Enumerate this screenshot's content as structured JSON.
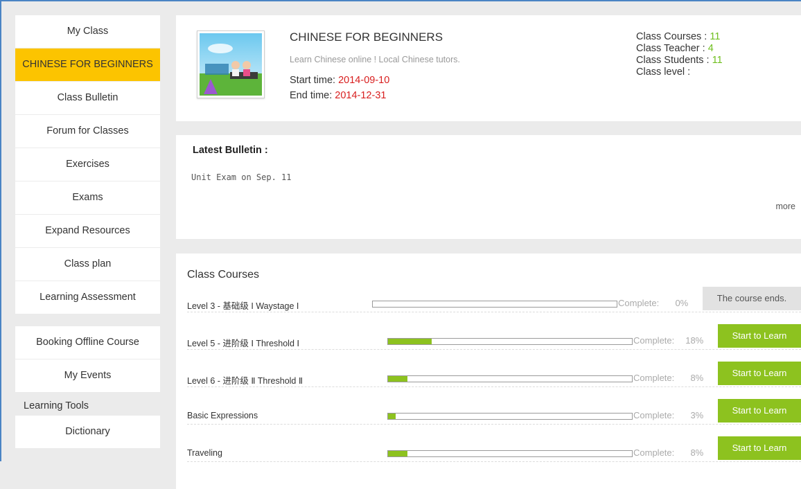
{
  "sidebar": {
    "main_items": [
      {
        "label": "My Class"
      },
      {
        "label": "CHINESE FOR BEGINNERS"
      },
      {
        "label": "Class Bulletin"
      },
      {
        "label": "Forum for Classes"
      },
      {
        "label": "Exercises"
      },
      {
        "label": "Exams"
      },
      {
        "label": "Expand Resources"
      },
      {
        "label": "Class plan"
      },
      {
        "label": "Learning Assessment"
      }
    ],
    "second_items": [
      {
        "label": "Booking Offline Course"
      },
      {
        "label": "My Events"
      }
    ],
    "tools_title": "Learning Tools",
    "tools_items": [
      {
        "label": "Dictionary"
      }
    ]
  },
  "class_info": {
    "title": "CHINESE FOR BEGINNERS",
    "subtitle": "Learn Chinese online ! Local Chinese tutors.",
    "start_label": "Start time:",
    "start_value": "2014-09-10",
    "end_label": "End time:",
    "end_value": "2014-12-31",
    "stats": {
      "courses_label": "Class Courses :",
      "courses_value": "11",
      "teacher_label": "Class Teacher :",
      "teacher_value": "4",
      "students_label": "Class Students :",
      "students_value": "11",
      "level_label": "Class level :"
    }
  },
  "bulletin": {
    "title": "Latest Bulletin :",
    "text": "Unit Exam on Sep. 11",
    "more": "more"
  },
  "courses": {
    "title": "Class Courses",
    "complete_label": "Complete:",
    "rows": [
      {
        "name": "Level 3 - 基础级 I  Waystage I",
        "percent_text": "0%",
        "progress": 0,
        "button": "The course ends."
      },
      {
        "name": "Level 5 - 进阶级 Ⅰ Threshold Ⅰ",
        "percent_text": "18%",
        "progress": 0.18,
        "button": "Start to Learn"
      },
      {
        "name": "Level 6 - 进阶级 Ⅱ Threshold Ⅱ",
        "percent_text": "8%",
        "progress": 0.08,
        "button": "Start to Learn"
      },
      {
        "name": "Basic Expressions",
        "percent_text": "3%",
        "progress": 0.03,
        "button": "Start to Learn"
      },
      {
        "name": "Traveling",
        "percent_text": "8%",
        "progress": 0.08,
        "button": "Start to Learn"
      }
    ]
  },
  "colors": {
    "active_nav": "#fcc400",
    "accent_green": "#8dc21f",
    "date_red": "#d81e1e"
  }
}
